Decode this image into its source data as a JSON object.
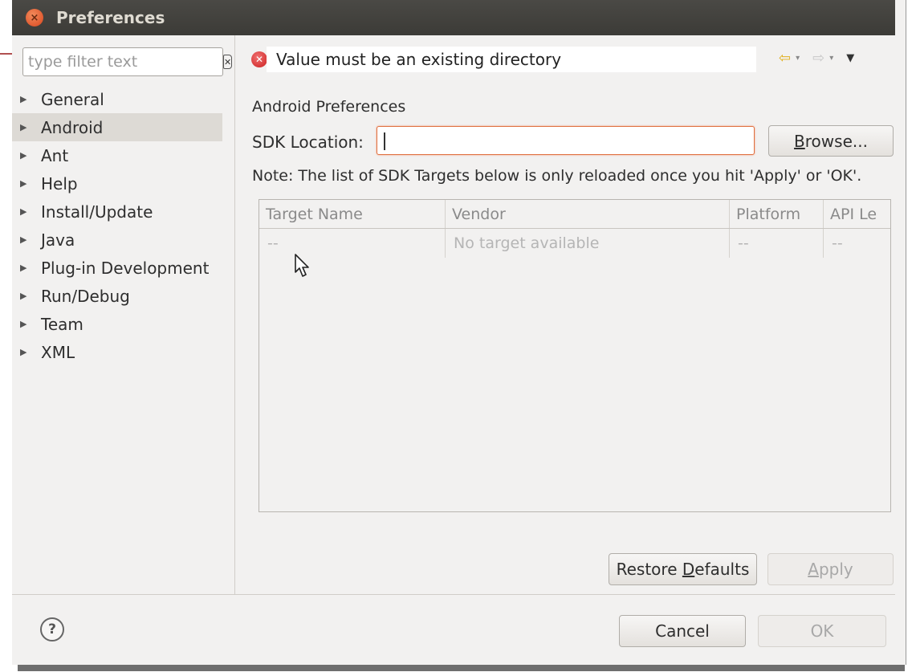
{
  "window": {
    "title": "Preferences"
  },
  "filter": {
    "placeholder": "type filter text"
  },
  "tree": {
    "items": [
      {
        "label": "General"
      },
      {
        "label": "Android",
        "selected": true
      },
      {
        "label": "Ant"
      },
      {
        "label": "Help"
      },
      {
        "label": "Install/Update"
      },
      {
        "label": "Java"
      },
      {
        "label": "Plug-in Development"
      },
      {
        "label": "Run/Debug"
      },
      {
        "label": "Team"
      },
      {
        "label": "XML"
      }
    ]
  },
  "message": {
    "text": "Value must be an existing directory",
    "icon": "error-icon"
  },
  "page": {
    "title": "Android Preferences",
    "sdk_label": "SDK Location:",
    "sdk_value": "",
    "browse": {
      "before": "",
      "mnemonic": "B",
      "after": "rowse..."
    },
    "note": "Note: The list of SDK Targets below is only reloaded once you hit 'Apply' or 'OK'."
  },
  "table": {
    "headers": [
      "Target Name",
      "Vendor",
      "Platform",
      "API Le"
    ],
    "rows": [
      [
        "--",
        "No target available",
        "--",
        "--"
      ]
    ]
  },
  "buttons": {
    "restore": {
      "before": "Restore ",
      "mnemonic": "D",
      "after": "efaults"
    },
    "apply": {
      "before": "",
      "mnemonic": "A",
      "after": "pply"
    },
    "cancel": "Cancel",
    "ok": "OK",
    "help": "?"
  },
  "colors": {
    "error": "#cc2020",
    "title_bar": "#3c3b37",
    "close": "#d9461e",
    "back_arrow": "#e0b020"
  }
}
